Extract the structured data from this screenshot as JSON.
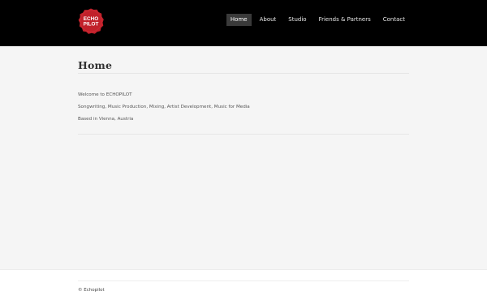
{
  "colors": {
    "header_bg": "#000000",
    "logo_red": "#c1202a",
    "page_bg": "#f5f5f5",
    "nav_active_bg": "#3a3a3a"
  },
  "header": {
    "logo": {
      "line1": "ECHO",
      "line2": "PILOT"
    },
    "nav": [
      {
        "label": "Home",
        "active": true
      },
      {
        "label": "About",
        "active": false
      },
      {
        "label": "Studio",
        "active": false
      },
      {
        "label": "Friends & Partners",
        "active": false
      },
      {
        "label": "Contact",
        "active": false
      }
    ]
  },
  "main": {
    "title": "Home",
    "paragraphs": [
      "Welcome to ECHOPILOT",
      "Songwriting, Music Production, Mixing, Artist Development, Music for Media",
      "Based in Vienna, Austria"
    ]
  },
  "footer": {
    "copyright": "© Echopilot"
  }
}
